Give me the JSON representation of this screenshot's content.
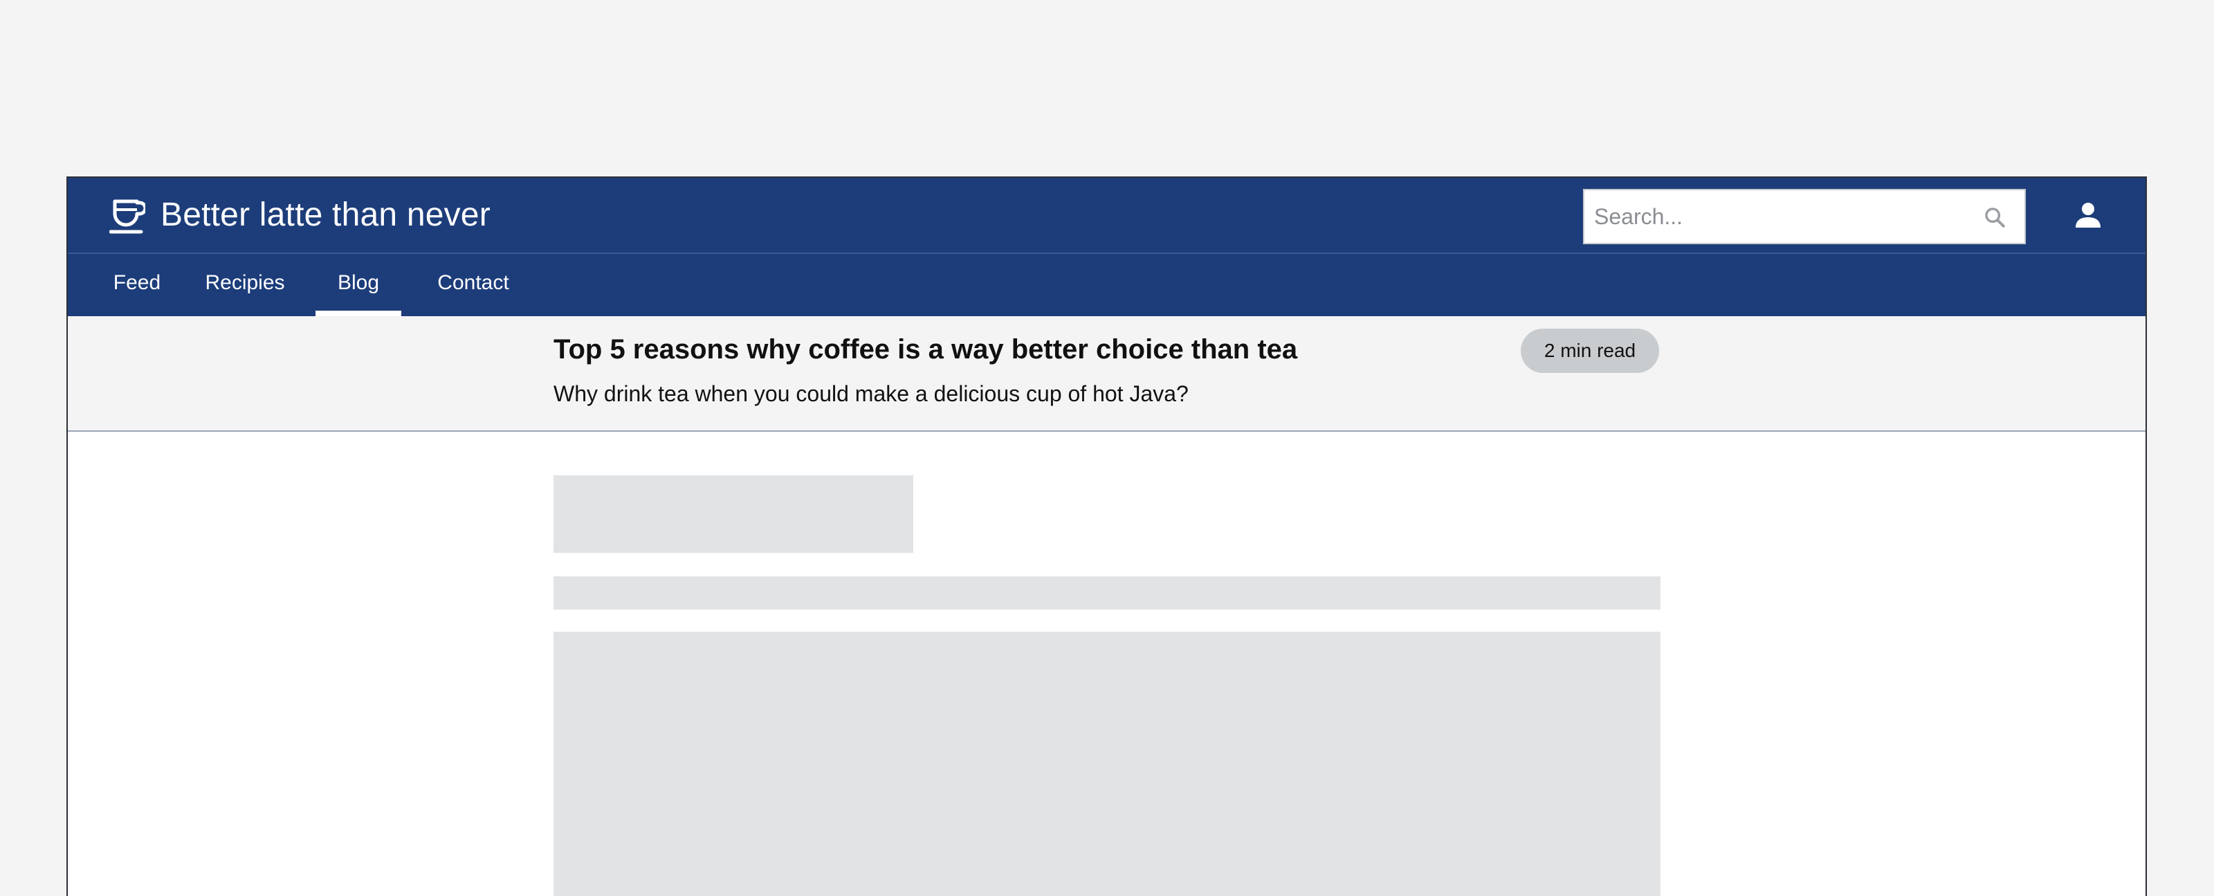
{
  "app": {
    "title": "Better latte than never"
  },
  "header": {
    "logo_icon": "coffee-cup-icon",
    "user_icon": "user-icon"
  },
  "search": {
    "placeholder": "Search...",
    "value": "",
    "icon": "search-icon"
  },
  "nav": {
    "items": [
      {
        "label": "Feed",
        "active": false
      },
      {
        "label": "Recipies",
        "active": false
      },
      {
        "label": "Blog",
        "active": true
      },
      {
        "label": "Contact",
        "active": false
      }
    ]
  },
  "article": {
    "title": "Top 5 reasons why coffee is a way better choice than tea",
    "subtitle": "Why drink tea when you could make a delicious cup of hot Java?",
    "read_time": "2 min read"
  },
  "colors": {
    "header_bg": "#1d3d7a",
    "page_bg": "#f4f4f4",
    "skeleton": "#e2e3e5",
    "badge_bg": "#c9cccf"
  }
}
